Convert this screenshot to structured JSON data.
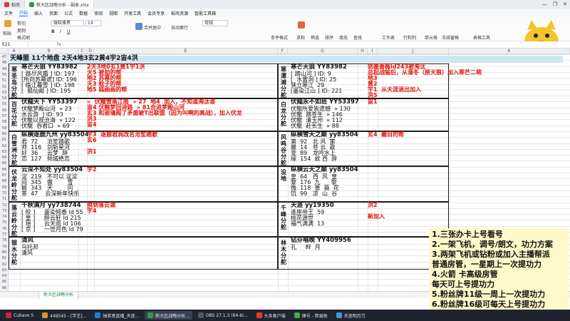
{
  "titlebar": {
    "tabs": [
      {
        "label": "稻壳"
      },
      {
        "label": "新大区战略分析 - 副本.xlsx"
      }
    ],
    "controls": [
      "—",
      "❐",
      "✕"
    ]
  },
  "menu": [
    "文件",
    "开始",
    "插入",
    "页面",
    "公式",
    "数据",
    "审阅",
    "视图",
    "开发工具",
    "会员专享",
    "稻壳资源",
    "智能工具箱"
  ],
  "ribbon": {
    "paste": "粘贴",
    "cut": "剪切",
    "copy": "复制",
    "format_painter": "格式刷",
    "font": "微软雅黑",
    "size": "14",
    "merge": "合并居中",
    "wrap": "自动换行",
    "format": "常规",
    "cond_format": "条件格式",
    "sum": "求和",
    "filter": "筛选",
    "sort": "排序",
    "fill": "填充",
    "find": "查找",
    "sheet": "工作表",
    "rowcol": "行和列",
    "cell": "单元格",
    "freeze": "冻结窗格",
    "table_tools": "表格工具"
  },
  "formula": {
    "name_box": "E21",
    "fx": "fx"
  },
  "columns": [
    "A",
    "B",
    "C",
    "D",
    "E",
    "F",
    "G",
    "H",
    "I",
    "J",
    "K"
  ],
  "rows": [
    "47",
    "48",
    "49",
    "50",
    "51",
    "52",
    "53",
    "54",
    "55",
    "56",
    "57",
    "58",
    "59",
    "60",
    "61",
    "62",
    "63",
    "64",
    "65",
    "66",
    "67",
    "68",
    "69",
    "70",
    "71",
    "72",
    "73",
    "74",
    "75",
    "76",
    "77",
    "78",
    "79",
    "80",
    "81",
    "82",
    "83",
    "84",
    "85",
    "86"
  ],
  "sheet": {
    "header": "天峰盟   11个地盘  2天4地3玄2黄4宇2宙4洪",
    "left": [
      {
        "v": "寒\n圣\n岛\n分\n舵",
        "title": "寒芒天狼  YY83982",
        "body": "[ 路尽风霜 ] ID: 197\n[所向苏幕遮] ID: 196\n[ 临江暮雪 ] ID: 198\n[  狐仙阁 ] ID: 195",
        "notes": "2天3地0玄1黄1宇1洪\n天5 被劫的帮\n地2 苏幕的帮\n天3 蚊子的帮\n地5 狐画画的帮"
      },
      {
        "v": "百\n花\n分\n舵",
        "title": "伏龍天下  YY53397",
        "body": "伏龍梦殿山河  » 23\n水云游  ] ID: 93\n伏龍以观沧海  » 122\n伏龍  吞君口  » 69",
        "notes": "»  伏龍雪落江南  » 27  地4  加入，不知道淘汰谁\n宙4 伏龍梦回诗路  » 81合进梦殿山河\n玄3 和玻璃阁了矛盾被T出联盟（因为叫啊的高战），加入伏龙\n洪3\n宙4"
      },
      {
        "v": "白\n雪\n洲\n分\n舵",
        "title": "纵横逐鹿九州  yy83504",
        "body": "君  72     沧笙踏歌\n帅  116   剑斩星河\n好  36     云梦  辞\n恋  127   倾城绝恋",
        "notes": "宇3  逐鹿君涧改名沧笙踏歌\n玄6\n\n洪1"
      },
      {
        "v": "伏\n龙\n岭\n分\n舵",
        "title": "云深不知处  yy83504",
        "body": "淀  219   不可以 淀淀\n间  345   傲        雪\n颖  343   天        问\n茶  47    云深新年快乐",
        "notes": "宇2"
      },
      {
        "v": "落\n云\n岭\n分\n舵",
        "title": "千秋满月  yy738744",
        "body": "[ 皎 ]     墨染倾香 ld 55\n[ 皇 ]     醉云轩 ld 215\n[ 瑶 ]     云天雨 ld 106\n[ 京 ]     一世月色 ld 79",
        "notes": "换到落云湖\n宇4"
      },
      {
        "v": "银\n水\n分\n舵",
        "title": "清风",
        "body": "乌托邦\n清风",
        "notes": ""
      }
    ],
    "right": [
      {
        "v": "寒\n潭\n滩\n分\n舵",
        "title": "寒芒天狼  YY83982",
        "body": "[ 踏山河 ] ID: 9\n[  水雾洞 ] ID: 25\n狭立寒江  29\n[墨染江山 ] ID: 221",
        "notes": "剑墨蔷薇id243被淘汰\n总起战输后，从溜冬（原天狼）加入寒芒二萌\n地3\n黄2\n宇1  从天涯退出加入\n洪5"
      },
      {
        "v": "白\n龙\n分\n舵",
        "title": "伏龍永不如班  YY53397",
        "body": "伏龍所爱皆遗憾  » 130\n伏龍  踏苍生  » 146\n伏龍  清玉州  » 112\n伏龍  赴长生  » 88",
        "notes": "宙1"
      },
      {
        "v": "风\n鸣\n谷\n分\n舵",
        "title": "纵横雪天之颠  yy83504",
        "body": "第  92   北 风  策\n搬  14   苍 云  歌\n变  89   龙吟水上\n缘  154  故 西  辞",
        "notes": "玄4  雕目的帮"
      },
      {
        "v": "没\n地",
        "title": "纵横云天之颠  yy83504",
        "body": "皇  64   西  风  皇\n黎  176  九      黎\n微  118  蔷  薇  花\n饥  99   凉  山  谷",
        "notes": ""
      },
      {
        "v": "千\n峰\n分\n舵",
        "title": "天涯  yy19350",
        "body": "谁座帝王  59\n桃花源世\n福气满满  13",
        "notes": "洪2\n\n新加入"
      },
      {
        "v": "林\n木\n分\n舵",
        "title": "钻芬唱晚  YY409956",
        "body": "孔     畔  月",
        "notes": ""
      }
    ]
  },
  "sheet_tab": "新大区战略分析",
  "overlay": [
    "1.三张办卡上号看号",
    "2.一架飞机，调号/朗文，功力方案",
    "3.两架飞机或钻粉或加入主播帮派",
    "普通房管，一星期上一次提功力",
    "4.火箭  卡高级房管",
    "每天可上号提功力",
    "5.粉丝牌11级一周上一次提功力",
    "6.粉丝牌16级可每天上号提功力"
  ],
  "taskbar": [
    {
      "label": "Cubase 5"
    },
    {
      "label": "449545 - [学艺]..."
    },
    {
      "label": "抽奖者直播_天涯..."
    },
    {
      "label": "新大区战略分析..."
    },
    {
      "label": "OBS 27.1.3 (64-bi..."
    },
    {
      "label": "头条客户端"
    },
    {
      "label": "锋号 - 简易助"
    },
    {
      "label": "天涯明月刀"
    }
  ],
  "colors": {
    "accent": "#1e8449",
    "red": "#e4140a",
    "overlay_bg": "#fff8c8"
  }
}
